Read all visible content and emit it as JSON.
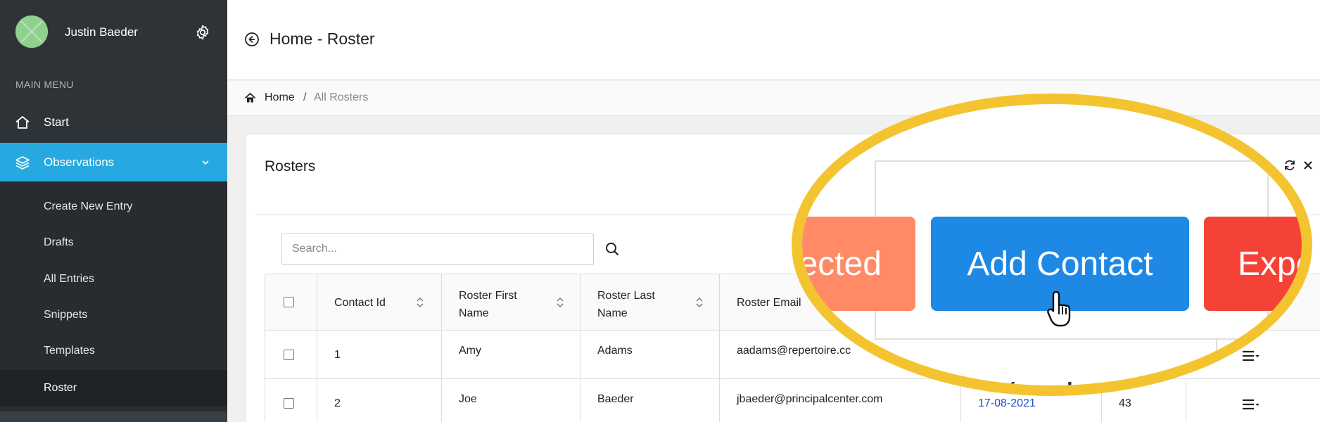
{
  "sidebar": {
    "user_name": "Justin Baeder",
    "menu_header": "MAIN MENU",
    "items": [
      {
        "label": "Start"
      },
      {
        "label": "Observations"
      }
    ],
    "sub_items": [
      {
        "label": "Create New Entry"
      },
      {
        "label": "Drafts"
      },
      {
        "label": "All Entries"
      },
      {
        "label": "Snippets"
      },
      {
        "label": "Templates"
      },
      {
        "label": "Roster"
      }
    ]
  },
  "header": {
    "title": "Home - Roster"
  },
  "breadcrumb": {
    "home": "Home",
    "separator": "/",
    "current": "All Rosters"
  },
  "card": {
    "title": "Rosters"
  },
  "search": {
    "placeholder": "Search..."
  },
  "table": {
    "columns": [
      "Contact Id",
      "Roster First Name",
      "Roster Last Name",
      "Roster Email"
    ],
    "rows": [
      {
        "contact_id": "1",
        "first": "Amy",
        "last": "Adams",
        "email": "aadams@repertoire.cc",
        "date": "",
        "count": ""
      },
      {
        "contact_id": "2",
        "first": "Joe",
        "last": "Baeder",
        "email": "jbaeder@principalcenter.com",
        "date": "17-08-2021",
        "count": "43"
      }
    ]
  },
  "zoom": {
    "selected_label": "ected",
    "add_contact_label": "Add Contact",
    "export_label": "Expo",
    "partial_text": "(m-d"
  },
  "colors": {
    "sidebar": "#2e3338",
    "active": "#25a9e0",
    "add_contact": "#1e88e5",
    "delete_selected": "#ff8a65",
    "export": "#f44336",
    "highlight": "#f4c430"
  }
}
